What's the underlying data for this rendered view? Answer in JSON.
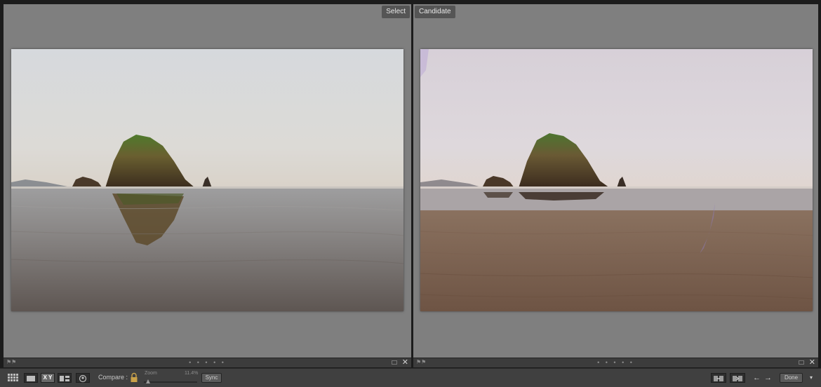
{
  "panes": {
    "left": {
      "label": "Select"
    },
    "right": {
      "label": "Candidate"
    }
  },
  "pane_toolbar": {
    "dots": "• • • • •",
    "close_glyph": "✕",
    "flag_glyph": "⚑⚑"
  },
  "bottom_bar": {
    "compare_label": "Compare :",
    "zoom_label": "Zoom",
    "zoom_value": "11.4%",
    "sync_label": "Sync",
    "done_label": "Done",
    "prev_arrow": "←",
    "next_arrow": "→",
    "dropdown_glyph": "▾",
    "view_xy_label": "X Y"
  },
  "icons": [
    "grid-view-icon",
    "loupe-view-icon",
    "compare-xy-icon",
    "survey-view-icon",
    "people-view-icon",
    "lock-icon",
    "swap-icon",
    "make-select-icon"
  ],
  "colors": {
    "background": "#1c1c1c",
    "pane": "#7f7f7f",
    "toolbar": "#404040"
  }
}
